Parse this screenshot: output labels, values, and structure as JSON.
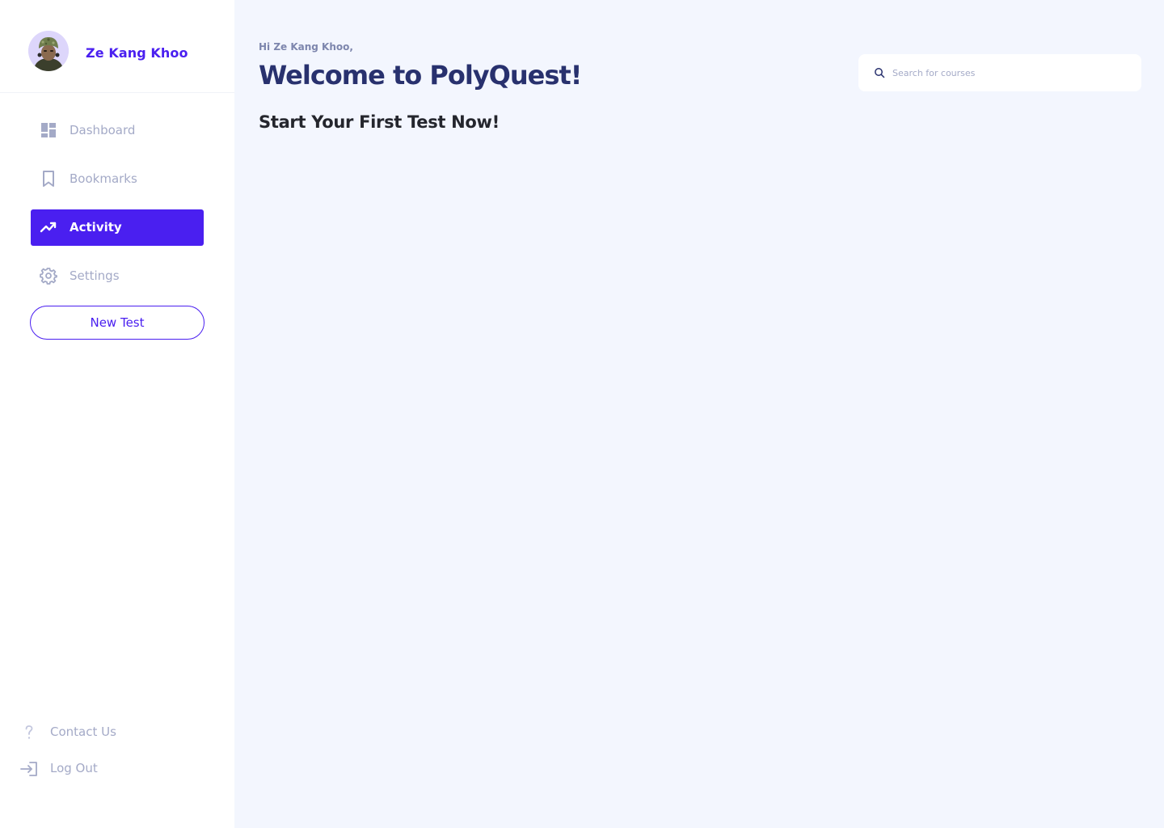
{
  "profile": {
    "name": "Ze Kang Khoo",
    "avatar_icon": "user-avatar-photo"
  },
  "nav": {
    "items": [
      {
        "label": "Dashboard",
        "icon": "dashboard-icon",
        "active": false
      },
      {
        "label": "Bookmarks",
        "icon": "bookmark-icon",
        "active": false
      },
      {
        "label": "Activity",
        "icon": "activity-trend-icon",
        "active": true
      },
      {
        "label": "Settings",
        "icon": "gear-icon",
        "active": false
      }
    ],
    "new_test_label": "New Test"
  },
  "footer": {
    "contact_label": "Contact Us",
    "contact_icon": "question-icon",
    "logout_label": "Log Out",
    "logout_icon": "logout-icon"
  },
  "main": {
    "greeting": "Hi Ze Kang Khoo,",
    "title": "Welcome to PolyQuest!",
    "subtitle": "Start Your First Test Now!"
  },
  "search": {
    "placeholder": "Search for courses",
    "value": "",
    "icon": "search-icon"
  },
  "colors": {
    "accent": "#4a1ff0",
    "page_background": "#f3f6fe",
    "sidebar_background": "#ffffff",
    "muted_text": "#a4aac7",
    "title_text": "#28316e"
  }
}
